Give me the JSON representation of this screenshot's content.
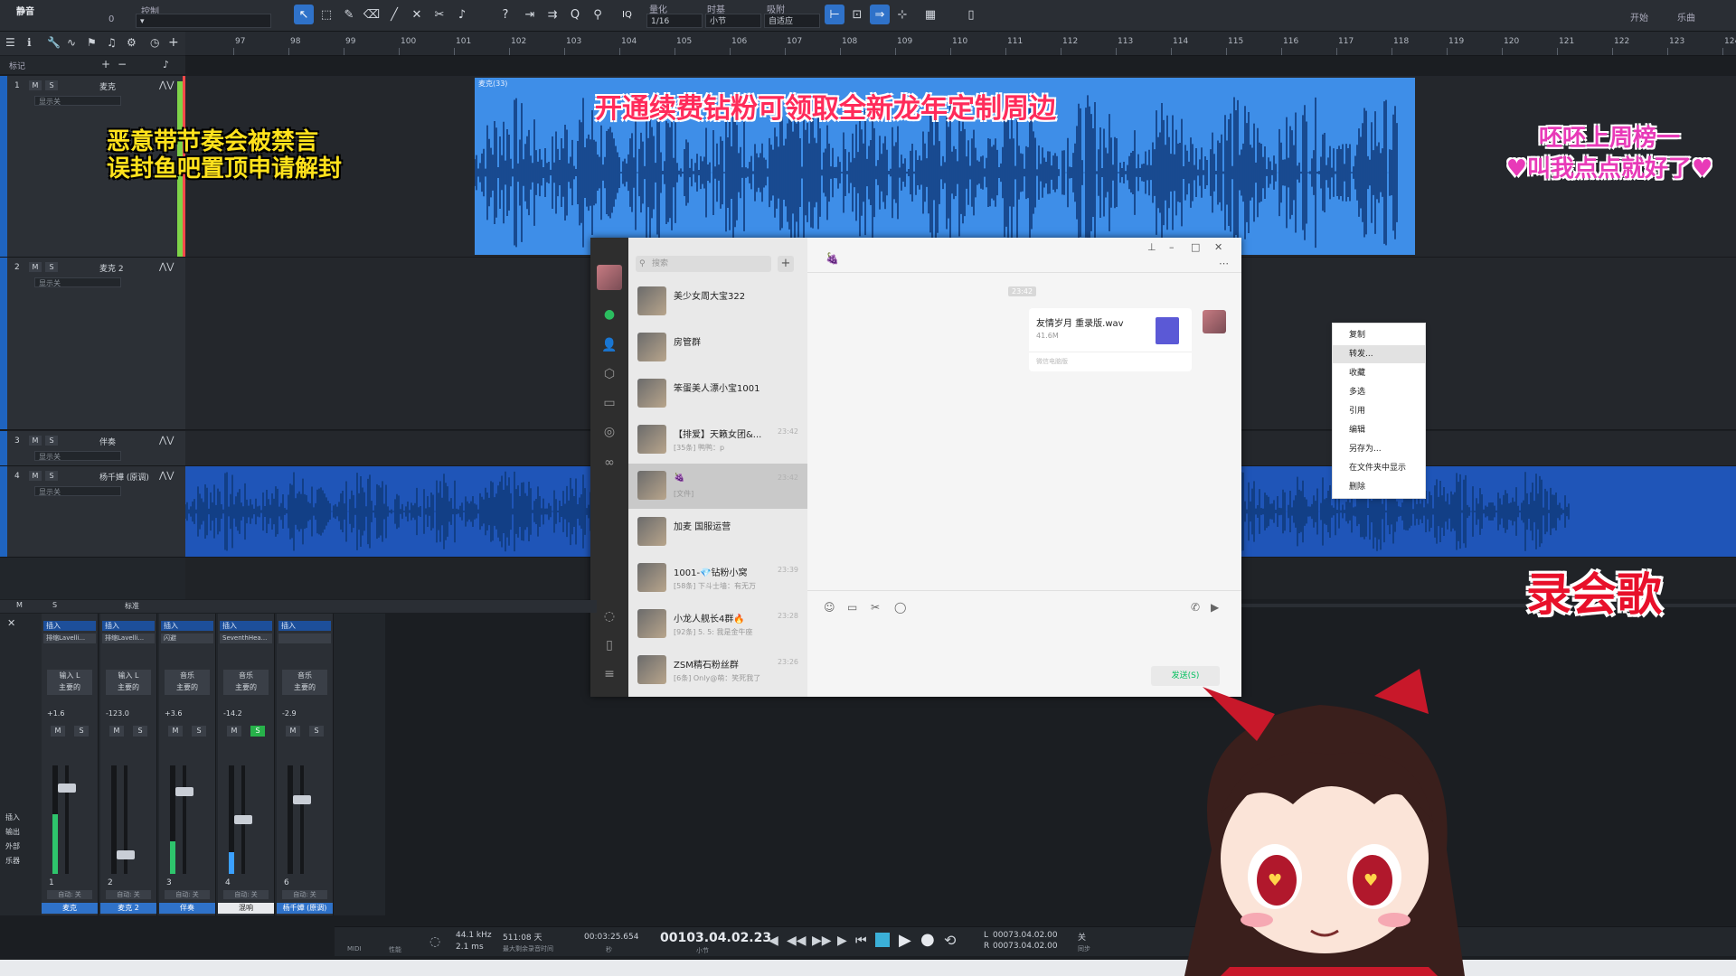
{
  "toolbar": {
    "mode_label": "静音",
    "control_label": "控制",
    "value_small": "0",
    "quantize_label": "量化",
    "quantize_value": "1/16",
    "timebase_label": "时基",
    "timebase_value": "小节",
    "snap_label": "吸附",
    "snap_value": "自适应",
    "iq": "IQ",
    "right_start": "开始",
    "right_song": "乐曲"
  },
  "ruler": [
    "97",
    "98",
    "99",
    "100",
    "101",
    "102",
    "103",
    "104",
    "105",
    "106",
    "107",
    "108",
    "109",
    "110",
    "111",
    "112",
    "113",
    "114",
    "115",
    "116",
    "117",
    "118",
    "119",
    "120",
    "121",
    "122",
    "123",
    "124"
  ],
  "marker_label": "标记",
  "tracks": [
    {
      "num": "1",
      "name": "麦克",
      "monitor": "显示关"
    },
    {
      "num": "2",
      "name": "麦克 2",
      "monitor": "显示关"
    },
    {
      "num": "3",
      "name": "伴奏",
      "monitor": "显示关"
    },
    {
      "num": "4",
      "name": "杨千嬅 (原调)",
      "monitor": "显示关"
    }
  ],
  "clip1_title": "麦克(33)",
  "overlays": {
    "warning_line1": "恶意带节奏会被禁言",
    "warning_line2": "误封鱼吧置顶申请解封",
    "promo": "开通续费钻粉可领取全新龙年定制周边",
    "pink_line1": "呸呸上周榜一",
    "pink_line2": "♥叫我点点就好了♥",
    "recording": "录会歌"
  },
  "chat": {
    "search_placeholder": "搜索",
    "add": "+",
    "conversations": [
      {
        "name": "美少女周大宝322",
        "sub": "",
        "time": ""
      },
      {
        "name": "房管群",
        "sub": "",
        "time": ""
      },
      {
        "name": "笨蛋美人漂小宝1001",
        "sub": "",
        "time": ""
      },
      {
        "name": "【排爱】天籁女团&...",
        "sub": "[35条] 鸭鸭：p",
        "time": "23:42"
      },
      {
        "name": "🍇",
        "sub": "[文件]",
        "time": "23:42"
      },
      {
        "name": "加麦 国服运营",
        "sub": "",
        "time": ""
      },
      {
        "name": "1001-💎钻粉小窝",
        "sub": "[58条] 下斗士墙：有无万",
        "time": "23:39"
      },
      {
        "name": "小龙人舰长4群🔥",
        "sub": "[92条] 5. 5: 我是金牛座",
        "time": "23:28"
      },
      {
        "name": "ZSM精石粉丝群",
        "sub": "[6条] Only@萌：笑死我了",
        "time": "23:26"
      }
    ],
    "header_name": "🍇",
    "timestamp": "23:42",
    "file_name": "友情岁月 重录版.wav",
    "file_size": "41.6M",
    "file_source": "微信电脑版",
    "send": "发送(S)",
    "menu": [
      "复制",
      "转发...",
      "收藏",
      "多选",
      "引用",
      "编辑",
      "另存为...",
      "在文件夹中显示",
      "删除"
    ]
  },
  "mixer_bar": {
    "m": "M",
    "s": "S",
    "std": "标准"
  },
  "mixer_side": [
    "插入",
    "输出",
    "外部",
    "乐器"
  ],
  "strips": [
    {
      "num": "1",
      "name": "麦克",
      "ins": "插入",
      "ins2": "排缩Lavelli...",
      "route1": "输入 L",
      "route2": "主要的",
      "vol": "+1.6",
      "level": 0.55,
      "fader": 0.82
    },
    {
      "num": "2",
      "name": "麦克 2",
      "ins": "插入",
      "ins2": "排缩Lavelli...",
      "route1": "输入 L",
      "route2": "主要的",
      "vol": "-123.0",
      "level": 0,
      "fader": 0.15
    },
    {
      "num": "3",
      "name": "伴奏",
      "ins": "插入",
      "ins2": "闪避",
      "route1": "音乐",
      "route2": "主要的",
      "vol": "+3.6",
      "level": 0.3,
      "fader": 0.78
    },
    {
      "num": "4",
      "name": "混响",
      "ins": "插入",
      "ins2": "SeventhHea...",
      "route1": "音乐",
      "route2": "主要的",
      "vol": "-14.2",
      "level": 0.2,
      "fader": 0.5
    },
    {
      "num": "6",
      "name": "杨千嬅 (原调)",
      "ins": "插入",
      "ins2": "",
      "route1": "音乐",
      "route2": "主要的",
      "vol": "-2.9",
      "level": 0,
      "fader": 0.7
    }
  ],
  "strip_auto": "自动: 关",
  "transport": {
    "midi": "MIDI",
    "perf": "性能",
    "rate": "44.1 kHz",
    "buffer": "2.1 ms",
    "days": "511:08 天",
    "days_label": "最大剩余录音时间",
    "time": "00:03:25.654",
    "time_unit": "秒",
    "bars": "00103.04.02.23",
    "bars_unit": "小节",
    "loop_l": "00073.04.02.00",
    "loop_r": "00073.04.02.00",
    "l": "L",
    "r": "R",
    "off": "关",
    "sync": "同步"
  }
}
